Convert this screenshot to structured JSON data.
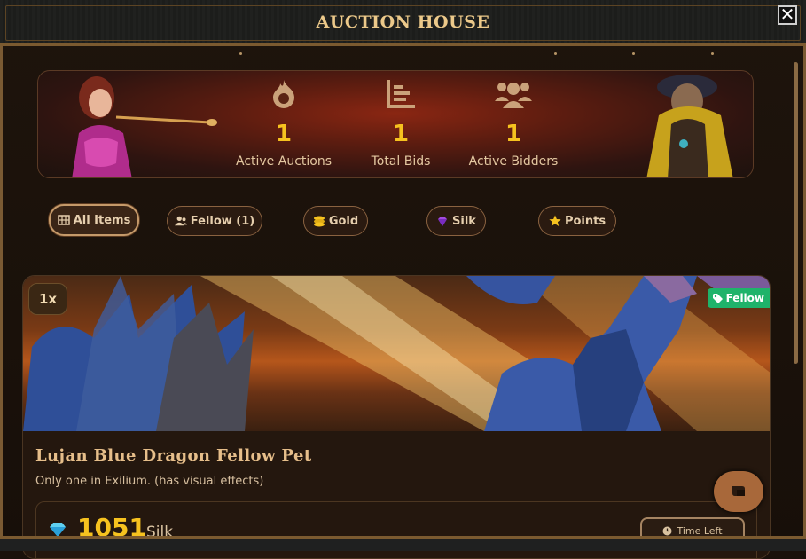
{
  "window": {
    "title": "AUCTION HOUSE",
    "close_label": "✕"
  },
  "stats": [
    {
      "icon": "fire-icon",
      "value": "1",
      "label": "Active Auctions"
    },
    {
      "icon": "bar-chart-icon",
      "value": "1",
      "label": "Total Bids"
    },
    {
      "icon": "users-icon",
      "value": "1",
      "label": "Active Bidders"
    }
  ],
  "filters": [
    {
      "icon": "grid-icon",
      "label": "All Items",
      "active": true
    },
    {
      "icon": "user-group-icon",
      "label": "Fellow (1)",
      "active": false
    },
    {
      "icon": "coins-icon",
      "label": "Gold",
      "active": false
    },
    {
      "icon": "gem-icon",
      "label": "Silk",
      "active": false
    },
    {
      "icon": "star-icon",
      "label": "Points",
      "active": false
    }
  ],
  "auction_item": {
    "quantity": "1x",
    "type_tag": "Fellow",
    "title": "Lujan Blue Dragon Fellow Pet",
    "description": "Only one in Exilium. (has visual effects)",
    "price_value": "1051",
    "price_currency": "Silk",
    "time_left_label": "Time Left"
  },
  "colors": {
    "accent_gold": "#f6c21f",
    "tag_green": "#1fb36a",
    "frame_bronze": "#7b5a30"
  }
}
